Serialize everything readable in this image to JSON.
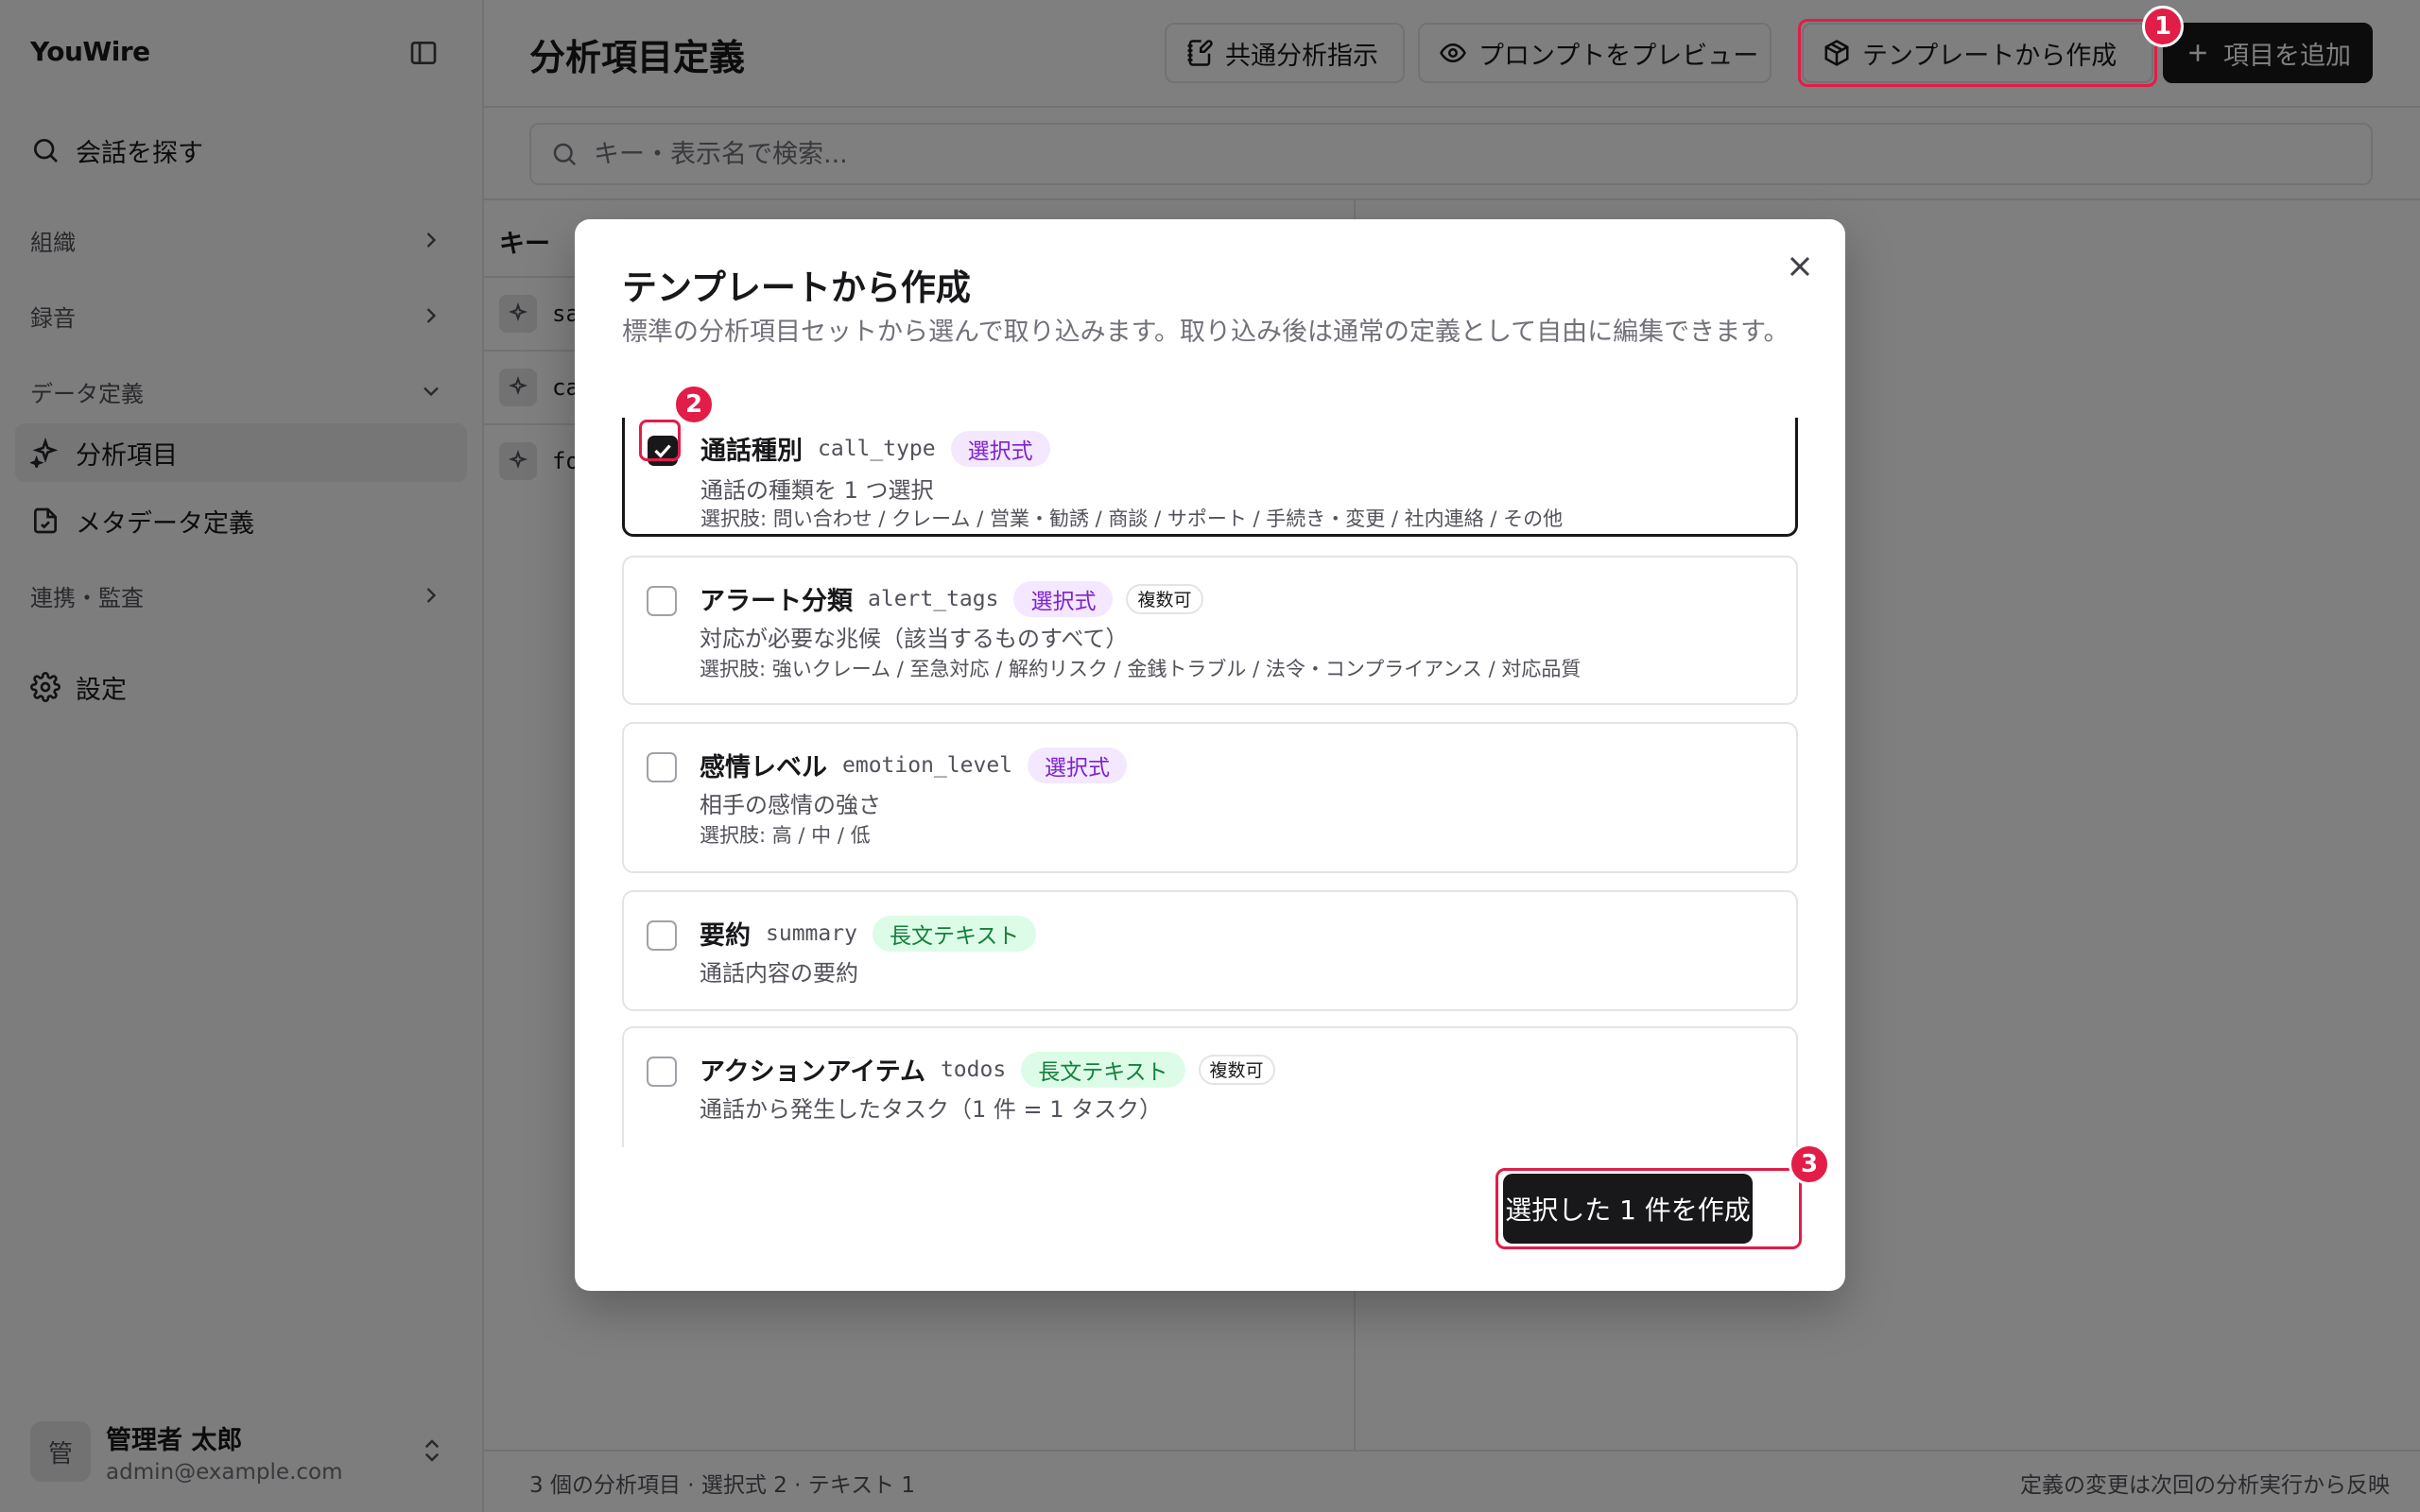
{
  "app": {
    "brand": "YouWire"
  },
  "sidebar": {
    "search_label": "会話を探す",
    "group_org": "組織",
    "group_recording": "録音",
    "group_data_def": "データ定義",
    "item_analysis": "分析項目",
    "item_metadata": "メタデータ定義",
    "group_integration": "連携・監査",
    "item_settings": "設定",
    "user": {
      "avatar": "管",
      "name": "管理者 太郎",
      "email": "admin@example.com"
    }
  },
  "header": {
    "title": "分析項目定義",
    "btn_common": "共通分析指示",
    "btn_preview": "プロンプトをプレビュー",
    "btn_template": "テンプレートから作成",
    "btn_add": "項目を追加"
  },
  "search": {
    "placeholder": "キー・表示名で検索..."
  },
  "list": {
    "col_key": "キー",
    "rows": [
      {
        "key": "sa"
      },
      {
        "key": "ca"
      },
      {
        "key": "fo"
      }
    ]
  },
  "footer": {
    "stats": "3 個の分析項目 · 選択式 2 · テキスト 1",
    "note": "定義の変更は次回の分析実行から反映"
  },
  "modal": {
    "title": "テンプレートから作成",
    "description": "標準の分析項目セットから選んで取り込みます。取り込み後は通常の定義として自由に編集できます。",
    "templates": [
      {
        "name": "通話種別",
        "key": "call_type",
        "type": "選択式",
        "multi": "",
        "checked": true,
        "desc": "通話の種類を 1 つ選択",
        "options": "選択肢: 問い合わせ / クレーム / 営業・勧誘 / 商談 / サポート / 手続き・変更 / 社内連絡 / その他"
      },
      {
        "name": "アラート分類",
        "key": "alert_tags",
        "type": "選択式",
        "multi": "複数可",
        "checked": false,
        "desc": "対応が必要な兆候（該当するものすべて）",
        "options": "選択肢: 強いクレーム / 至急対応 / 解約リスク / 金銭トラブル / 法令・コンプライアンス / 対応品質"
      },
      {
        "name": "感情レベル",
        "key": "emotion_level",
        "type": "選択式",
        "multi": "",
        "checked": false,
        "desc": "相手の感情の強さ",
        "options": "選択肢: 高 / 中 / 低"
      },
      {
        "name": "要約",
        "key": "summary",
        "type": "長文テキスト",
        "multi": "",
        "checked": false,
        "desc": "通話内容の要約",
        "options": ""
      },
      {
        "name": "アクションアイテム",
        "key": "todos",
        "type": "長文テキスト",
        "multi": "複数可",
        "checked": false,
        "desc": "通話から発生したタスク（1 件 = 1 タスク）",
        "options": ""
      }
    ],
    "create_button": "選択した 1 件を作成"
  },
  "annotations": {
    "step1": "1",
    "step2": "2",
    "step3": "3"
  },
  "colors": {
    "highlight": "#e11d48",
    "primary": "#18181b",
    "badge_select": "#7e22ce",
    "badge_text": "#15803d"
  }
}
